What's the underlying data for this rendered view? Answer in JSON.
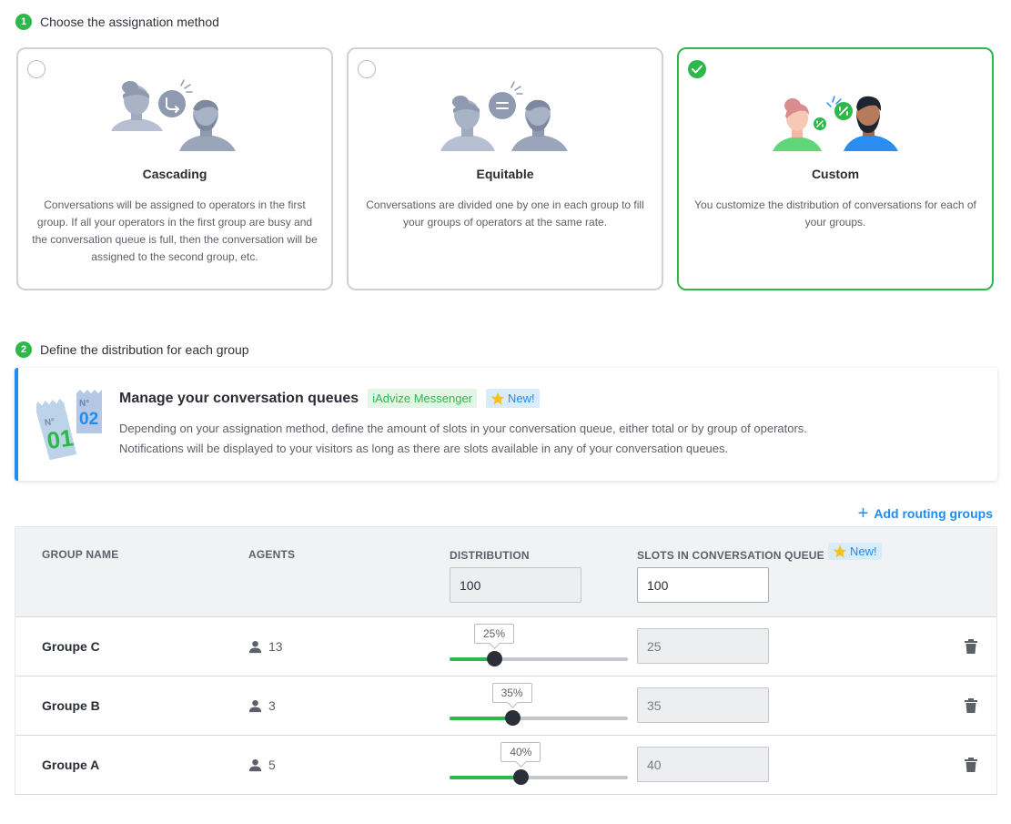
{
  "step1": {
    "number": "1",
    "label": "Choose the assignation method"
  },
  "methods": [
    {
      "title": "Cascading",
      "description": "Conversations will be assigned to operators in the first group. If all your operators in the first group are busy and the conversation queue is full, then the conversation will be assigned to the second group, etc.",
      "selected": false
    },
    {
      "title": "Equitable",
      "description": "Conversations are divided one by one in each group to fill your groups of operators at the same rate.",
      "selected": false
    },
    {
      "title": "Custom",
      "description": "You customize the distribution of conversations for each of your groups.",
      "selected": true
    }
  ],
  "step2": {
    "number": "2",
    "label": "Define the distribution for each group"
  },
  "banner": {
    "title": "Manage your conversation queues",
    "badge_product": "iAdvize Messenger",
    "badge_new": "New!",
    "line1": "Depending on your assignation method, define the amount of slots in your conversation queue, either total or by group of operators.",
    "line2": "Notifications will be displayed to your visitors as long as there are slots available in any of your conversation queues.",
    "ticket1": "01",
    "ticket2": "02",
    "ticket_no": "N°"
  },
  "add_routing": "Add routing groups",
  "table": {
    "headers": {
      "group_name": "GROUP NAME",
      "agents": "AGENTS",
      "distribution": "DISTRIBUTION",
      "slots": "SLOTS IN CONVERSATION QUEUE",
      "slots_badge": "New!"
    },
    "distribution_total": "100",
    "slots_total": "100",
    "rows": [
      {
        "name": "Groupe C",
        "agents": "13",
        "percent_label": "25%",
        "percent": 25,
        "slots": "25"
      },
      {
        "name": "Groupe B",
        "agents": "3",
        "percent_label": "35%",
        "percent": 35,
        "slots": "35"
      },
      {
        "name": "Groupe A",
        "agents": "5",
        "percent_label": "40%",
        "percent": 40,
        "slots": "40"
      }
    ]
  },
  "colors": {
    "green": "#2db84b",
    "blue": "#1f8cf0",
    "grey_border": "#cfd1d6",
    "illustration_grey": "#a9b4c8"
  },
  "icons": [
    "check-icon",
    "user-icon",
    "trash-icon",
    "star-icon",
    "plus-icon"
  ]
}
